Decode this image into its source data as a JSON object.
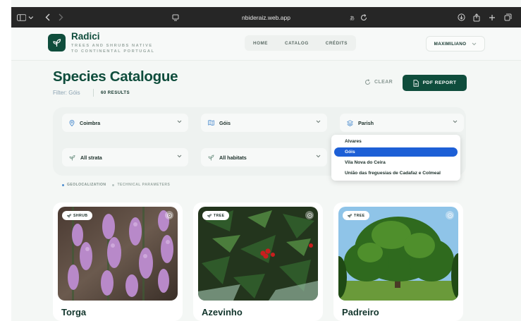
{
  "browser": {
    "url": "nbideraiz.web.app",
    "colors": {
      "chrome": "#262626"
    }
  },
  "app": {
    "brand": "Radici",
    "tagline_line1": "TREES AND SHRUBS NATIVE",
    "tagline_line2": "TO CONTINENTAL PORTUGAL",
    "nav": [
      "HOME",
      "CATALOG",
      "CRÉDITS"
    ],
    "user": "MAXIMILIANO",
    "colors": {
      "primary": "#0f4d3c",
      "highlight": "#1d5fd6"
    }
  },
  "page": {
    "title": "Species Catalogue",
    "filter_text": "Filter: Góis",
    "results": "60 RESULTS",
    "clear_label": "CLEAR",
    "pdf_label": "PDF REPORT"
  },
  "filters": {
    "district": "Coimbra",
    "municipality": "Góis",
    "parish_placeholder": "Parish",
    "strata": "All strata",
    "habitats": "All habitats"
  },
  "parish_dropdown": {
    "options": [
      "Alvares",
      "Góis",
      "Vila Nova do Ceira",
      "União das freguesias de Cadafaz e Colmeal"
    ],
    "selected_index": 1
  },
  "section_tabs": [
    "GEOLOCALIZATION",
    "TECHNICAL PARAMETERS"
  ],
  "cards": [
    {
      "type": "SHRUB",
      "name": "Torga"
    },
    {
      "type": "TREE",
      "name": "Azevinho"
    },
    {
      "type": "TREE",
      "name": "Padreiro"
    }
  ]
}
